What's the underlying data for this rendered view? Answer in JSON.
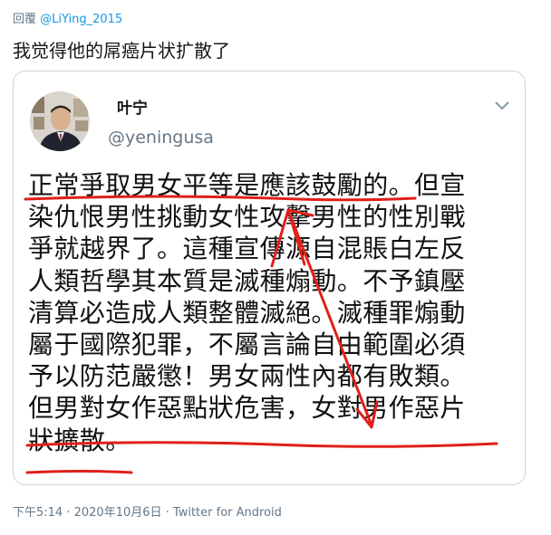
{
  "reply": {
    "prefix": "回覆",
    "handle": "@LiYing_2015"
  },
  "tweet": {
    "text": "我觉得他的屌癌片状扩散了"
  },
  "quoted": {
    "name": "叶宁",
    "handle": "@yeningusa",
    "lines": [
      "正常爭取男女平等是應該鼓勵的。但宣",
      "染仇恨男性挑動女性攻擊男性的性別戰",
      "爭就越界了。這種宣傳源自混賬白左反",
      "人類哲學其本質是滅種煽動。不予鎮壓",
      "清算必造成人類整體滅絕。滅種罪煽動",
      "屬于國際犯罪，不屬言論自由範圍必須",
      "予以防范嚴懲！男女兩性內都有敗類。",
      "但男對女作惡點狀危害，女對男作惡片",
      "狀擴散。"
    ]
  },
  "footer": {
    "time": "下午5:14",
    "separator1": " · ",
    "date": "2020年10月6日",
    "separator2": " · ",
    "source": "Twitter for Android"
  },
  "colors": {
    "accent": "#1b95e0",
    "secondary_text": "#657786",
    "border": "#ccd6dd",
    "annotation_red": "#e0201b"
  },
  "icons": {
    "caret": "chevron-down-icon",
    "avatar": "avatar-photo"
  }
}
